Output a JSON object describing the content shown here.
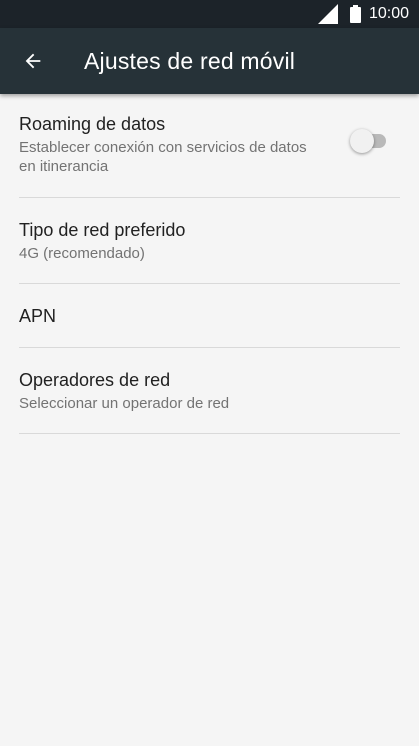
{
  "status_bar": {
    "time": "10:00",
    "icons": [
      "cell-signal-icon",
      "battery-icon"
    ]
  },
  "app_bar": {
    "back_icon": "arrow-back-icon",
    "title": "Ajustes de red móvil",
    "background": "#263238"
  },
  "settings": {
    "items": [
      {
        "title": "Roaming de datos",
        "subtitle": "Establecer conexión con servicios de datos en itinerancia",
        "toggle_on": false
      },
      {
        "title": "Tipo de red preferido",
        "subtitle": "4G (recomendado)"
      },
      {
        "title": "APN"
      },
      {
        "title": "Operadores de red",
        "subtitle": "Seleccionar un operador de red"
      }
    ]
  }
}
